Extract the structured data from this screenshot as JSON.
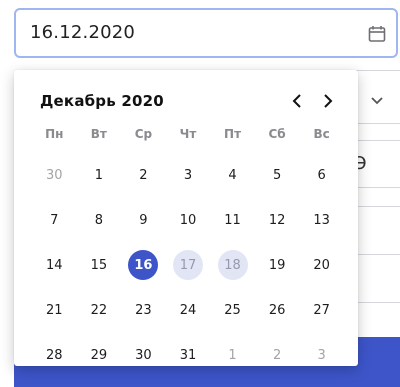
{
  "date_input": {
    "value": "16.12.2020",
    "icon": "calendar-icon"
  },
  "background": {
    "partial_field_text": "Э"
  },
  "calendar": {
    "month_title": "Декабрь 2020",
    "weekdays": [
      "Пн",
      "Вт",
      "Ср",
      "Чт",
      "Пт",
      "Сб",
      "Вс"
    ],
    "weeks": [
      [
        {
          "label": "30",
          "state": "outside"
        },
        {
          "label": "1",
          "state": "normal"
        },
        {
          "label": "2",
          "state": "normal"
        },
        {
          "label": "3",
          "state": "normal"
        },
        {
          "label": "4",
          "state": "normal"
        },
        {
          "label": "5",
          "state": "normal"
        },
        {
          "label": "6",
          "state": "normal"
        }
      ],
      [
        {
          "label": "7",
          "state": "normal"
        },
        {
          "label": "8",
          "state": "normal"
        },
        {
          "label": "9",
          "state": "normal"
        },
        {
          "label": "10",
          "state": "normal"
        },
        {
          "label": "11",
          "state": "normal"
        },
        {
          "label": "12",
          "state": "normal"
        },
        {
          "label": "13",
          "state": "normal"
        }
      ],
      [
        {
          "label": "14",
          "state": "normal"
        },
        {
          "label": "15",
          "state": "normal"
        },
        {
          "label": "16",
          "state": "selected"
        },
        {
          "label": "17",
          "state": "in-range"
        },
        {
          "label": "18",
          "state": "in-range"
        },
        {
          "label": "19",
          "state": "normal"
        },
        {
          "label": "20",
          "state": "normal"
        }
      ],
      [
        {
          "label": "21",
          "state": "normal"
        },
        {
          "label": "22",
          "state": "normal"
        },
        {
          "label": "23",
          "state": "normal"
        },
        {
          "label": "24",
          "state": "normal"
        },
        {
          "label": "25",
          "state": "normal"
        },
        {
          "label": "26",
          "state": "normal"
        },
        {
          "label": "27",
          "state": "normal"
        }
      ],
      [
        {
          "label": "28",
          "state": "normal"
        },
        {
          "label": "29",
          "state": "normal"
        },
        {
          "label": "30",
          "state": "normal"
        },
        {
          "label": "31",
          "state": "normal"
        },
        {
          "label": "1",
          "state": "outside"
        },
        {
          "label": "2",
          "state": "outside"
        },
        {
          "label": "3",
          "state": "outside"
        }
      ]
    ]
  },
  "colors": {
    "accent": "#3d55c9",
    "range_highlight": "#e2e6f4",
    "input_border": "#9fb6f1"
  }
}
